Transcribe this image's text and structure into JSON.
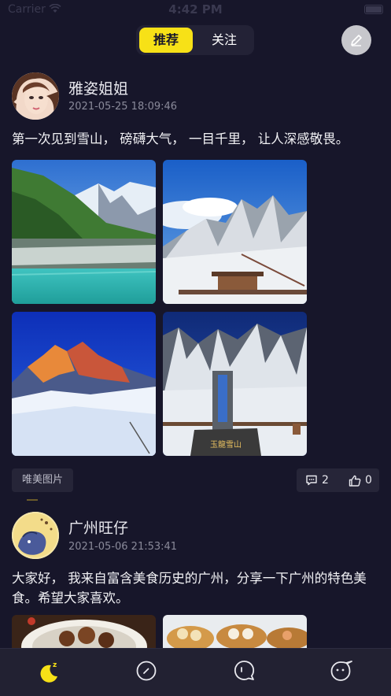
{
  "status_bar": {
    "carrier": "Carrier",
    "time": "4:42 PM"
  },
  "header": {
    "tabs": [
      {
        "label": "推荐",
        "active": true
      },
      {
        "label": "关注",
        "active": false
      }
    ],
    "edit_icon": "pencil-icon"
  },
  "posts": [
    {
      "username": "雅姿姐姐",
      "timestamp": "2021-05-25 18:09:46",
      "content": "第一次见到雪山， 磅礴大气， 一目千里， 让人深感敬畏。",
      "images": [
        "lake-and-snow-mountain",
        "snow-peaks-with-viewing-deck",
        "sunset-snow-mountain",
        "jade-dragon-snow-mountain-stone"
      ],
      "stone_text": "玉龍雪山",
      "tag": "唯美图片",
      "comments": "2",
      "likes": "0"
    },
    {
      "username": "广州旺仔",
      "timestamp": "2021-05-06 21:53:41",
      "content": "大家好， 我来自富含美食历史的广州，分享一下广州的特色美食。希望大家喜欢。",
      "images": [
        "dim-sum-plate",
        "dim-sum-baskets"
      ]
    }
  ],
  "tab_bar": [
    {
      "name": "moon-home-icon",
      "active": true
    },
    {
      "name": "compass-icon",
      "active": false
    },
    {
      "name": "message-icon",
      "active": false
    },
    {
      "name": "profile-icon",
      "active": false
    }
  ],
  "colors": {
    "accent": "#f7e117",
    "background": "#17162a",
    "card": "#262538"
  }
}
